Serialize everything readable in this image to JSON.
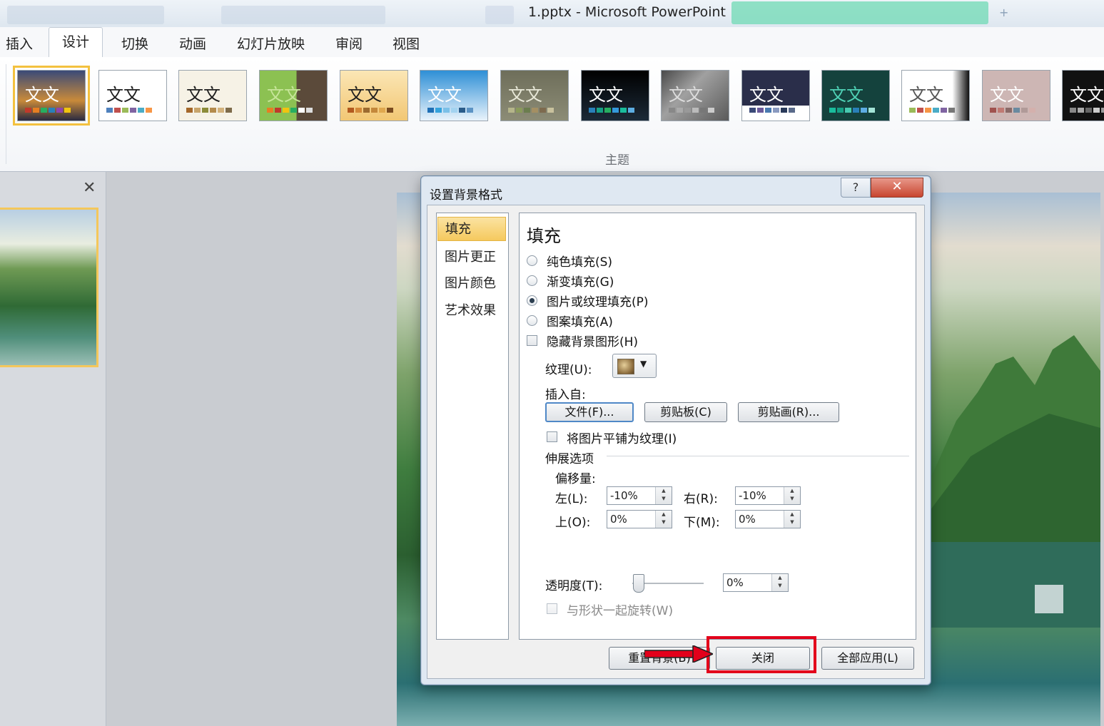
{
  "window": {
    "title": "1.pptx  -  Microsoft PowerPoint"
  },
  "ribbon": {
    "tabs": [
      {
        "label": "插入"
      },
      {
        "label": "设计"
      },
      {
        "label": "切换"
      },
      {
        "label": "动画"
      },
      {
        "label": "幻灯片放映"
      },
      {
        "label": "审阅"
      },
      {
        "label": "视图"
      }
    ],
    "active_tab": "设计",
    "group_label": "主题",
    "themes": [
      {
        "glyph": "文文"
      },
      {
        "glyph": "文文"
      },
      {
        "glyph": "文文"
      },
      {
        "glyph": "文文"
      },
      {
        "glyph": "文文"
      },
      {
        "glyph": "文文"
      },
      {
        "glyph": "文文"
      },
      {
        "glyph": "文文"
      },
      {
        "glyph": "文文"
      },
      {
        "glyph": "文文"
      },
      {
        "glyph": "文文"
      },
      {
        "glyph": "文文"
      },
      {
        "glyph": "文文"
      },
      {
        "glyph": "文文"
      }
    ]
  },
  "left_pane": {
    "close_glyph": "✕"
  },
  "dialog": {
    "title": "设置背景格式",
    "help_glyph": "?",
    "close_glyph": "✕",
    "nav": [
      {
        "label": "填充"
      },
      {
        "label": "图片更正"
      },
      {
        "label": "图片颜色"
      },
      {
        "label": "艺术效果"
      }
    ],
    "section_title": "填充",
    "fill_options": [
      {
        "label": "纯色填充(S)",
        "selected": false
      },
      {
        "label": "渐变填充(G)",
        "selected": false
      },
      {
        "label": "图片或纹理填充(P)",
        "selected": true
      },
      {
        "label": "图案填充(A)",
        "selected": false
      }
    ],
    "hide_bg_graphics": "隐藏背景图形(H)",
    "texture_label": "纹理(U):",
    "insert_from_label": "插入自:",
    "buttons": {
      "file": "文件(F)...",
      "clipboard": "剪贴板(C)",
      "clipart": "剪贴画(R)..."
    },
    "tile_as_texture": "将图片平铺为纹理(I)",
    "stretch_options": "伸展选项",
    "offset_label": "偏移量:",
    "offsets": {
      "left_label": "左(L):",
      "left_value": "-10%",
      "right_label": "右(R):",
      "right_value": "-10%",
      "top_label": "上(O):",
      "top_value": "0%",
      "bottom_label": "下(M):",
      "bottom_value": "0%"
    },
    "transparency_label": "透明度(T):",
    "transparency_value": "0%",
    "rotate_with_shape": "与形状一起旋转(W)",
    "footer": {
      "reset": "重置背景(B)",
      "close": "关闭",
      "apply_all": "全部应用(L)"
    }
  },
  "colors": {
    "highlight": "#e3001b",
    "selected_nav": "#f5c95e",
    "dialog_close": "#c8452f"
  }
}
